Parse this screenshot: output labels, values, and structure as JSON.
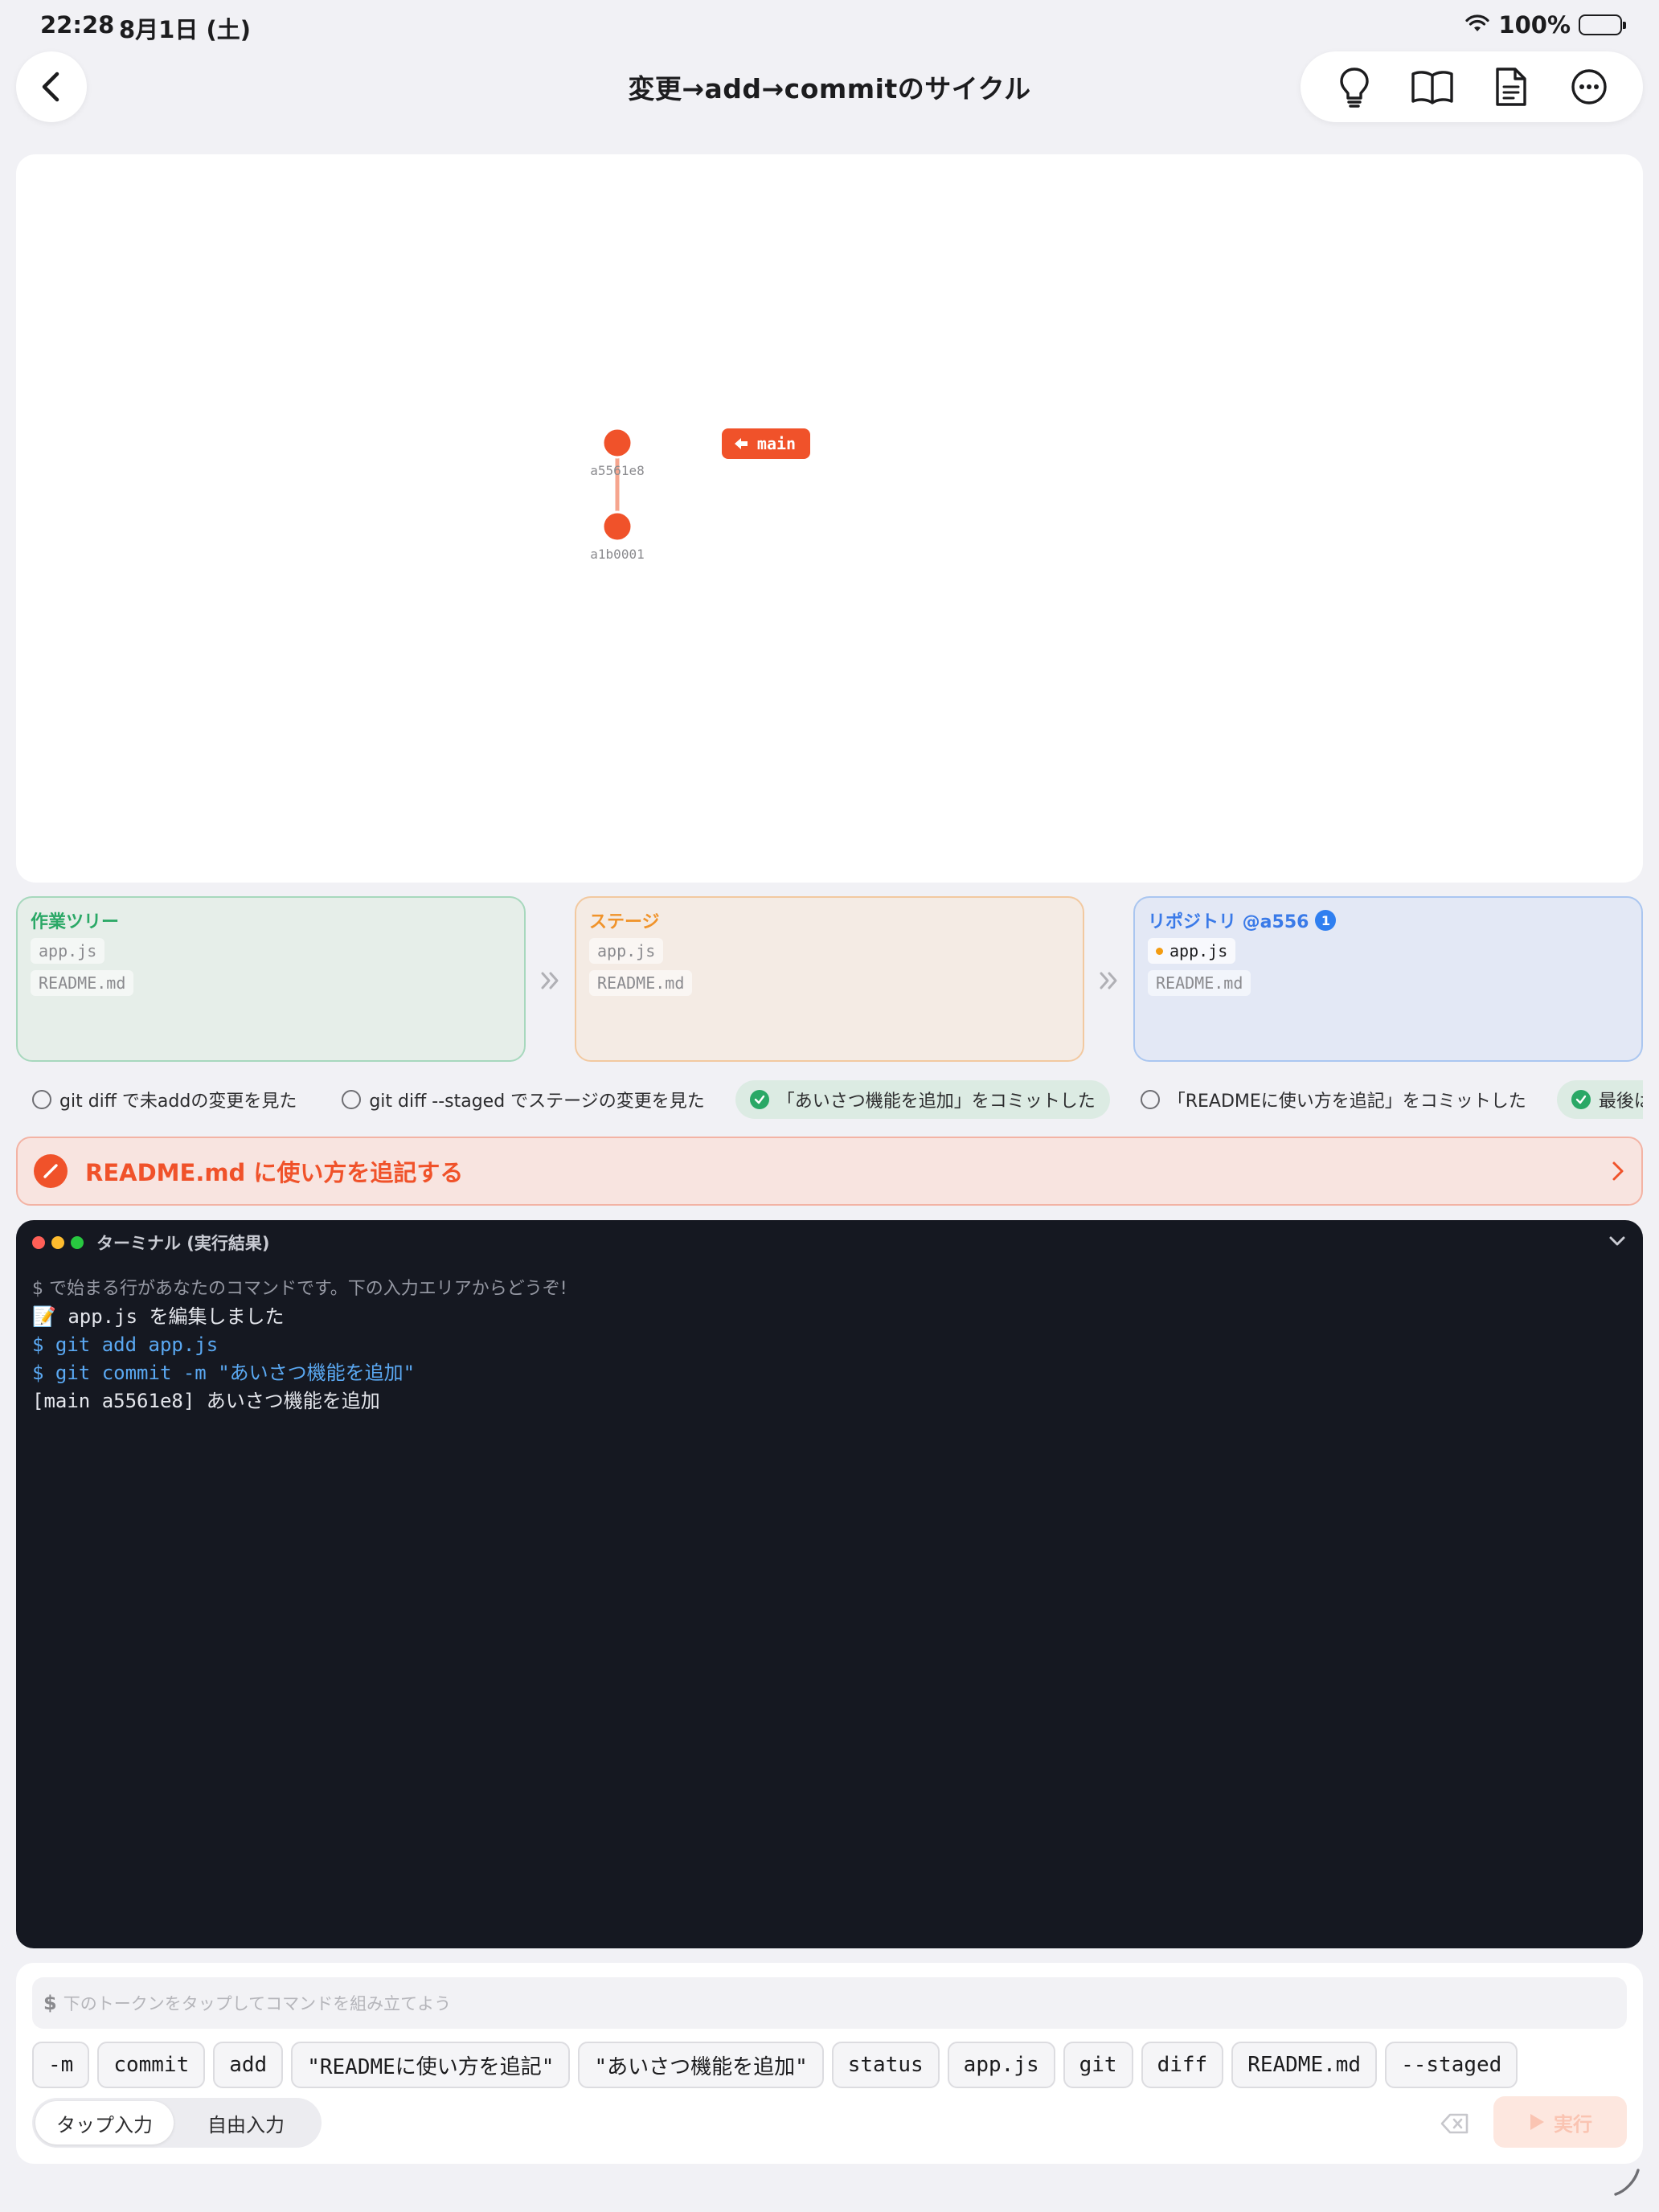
{
  "status_bar": {
    "time": "22:28",
    "date": "8月1日 (土)",
    "battery": "100%"
  },
  "nav": {
    "title": "変更→add→commitのサイクル",
    "toolbar_icons": [
      "lightbulb-icon",
      "book-icon",
      "document-icon",
      "more-icon"
    ]
  },
  "graph": {
    "commits": [
      {
        "id": "a5561e8"
      },
      {
        "id": "a1b0001"
      }
    ],
    "branch_label": "main",
    "accent_color": "#f0522a"
  },
  "areas": {
    "worktree": {
      "title": "作業ツリー",
      "files": [
        "app.js",
        "README.md"
      ]
    },
    "stage": {
      "title": "ステージ",
      "files": [
        "app.js",
        "README.md"
      ]
    },
    "repo": {
      "title": "リポジトリ @a556",
      "badge": "1",
      "files": [
        "app.js",
        "README.md"
      ],
      "changed_file": "app.js"
    }
  },
  "checklist": [
    {
      "label": "git diff で未addの変更を見た",
      "done": false
    },
    {
      "label": "git diff --staged でステージの変更を見た",
      "done": false
    },
    {
      "label": "「あいさつ機能を追加」をコミットした",
      "done": true
    },
    {
      "label": "「READMEに使い方を追記」をコミットした",
      "done": false
    },
    {
      "label": "最後は作業ツリーが",
      "done": true
    }
  ],
  "task": {
    "label": "README.md に使い方を追記する"
  },
  "terminal": {
    "title": "ターミナル (実行結果)",
    "lines": [
      {
        "type": "hint",
        "text": "$ で始まる行があなたのコマンドです。下の入力エリアからどうぞ!"
      },
      {
        "type": "output",
        "text": "📝 app.js を編集しました"
      },
      {
        "type": "cmd",
        "text": "$ git add app.js"
      },
      {
        "type": "cmd",
        "text": "$ git commit -m \"あいさつ機能を追加\""
      },
      {
        "type": "output",
        "text": "[main a5561e8] あいさつ機能を追加"
      }
    ]
  },
  "input": {
    "prompt": "$",
    "placeholder": "下のトークンをタップしてコマンドを組み立てよう",
    "tokens": [
      "-m",
      "commit",
      "add",
      "\"READMEに使い方を追記\"",
      "\"あいさつ機能を追加\"",
      "status",
      "app.js",
      "git",
      "diff",
      "README.md",
      "--staged"
    ],
    "modes": {
      "tap": "タップ入力",
      "free": "自由入力"
    },
    "run_label": "実行"
  },
  "colors": {
    "accent": "#f0522a",
    "worktree": "#2aa866",
    "stage": "#f0932a",
    "repo": "#3a7ae8"
  }
}
